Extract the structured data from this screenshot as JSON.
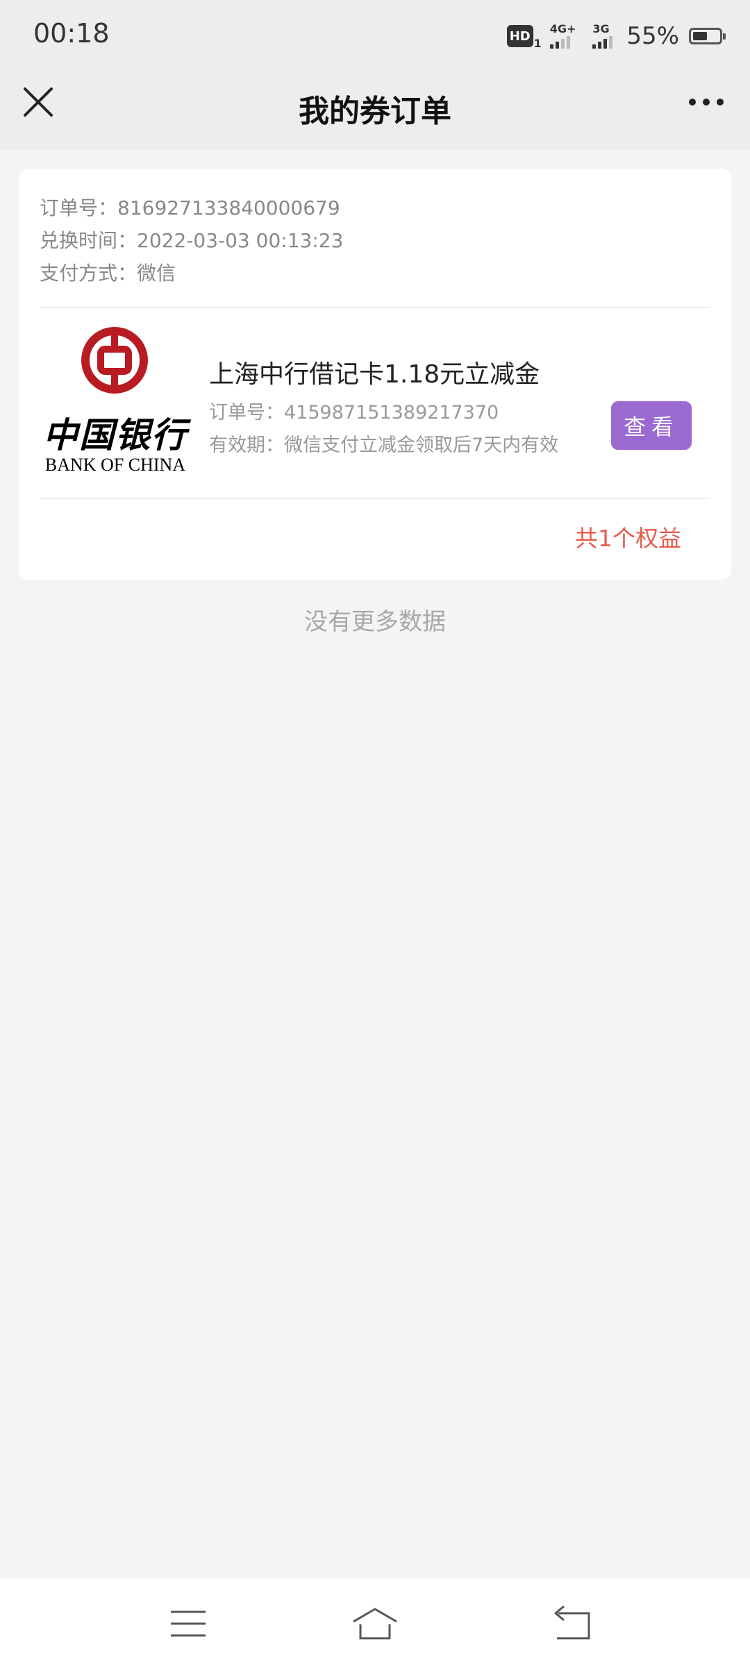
{
  "status_bar": {
    "time": "00:18",
    "hd_label": "HD",
    "hd_sub": "1",
    "network_1": "4G+",
    "network_2": "3G",
    "battery_percent": "55%",
    "battery_level": 0.55
  },
  "nav": {
    "title": "我的券订单",
    "close_icon": "close-icon",
    "more_icon": "more-icon"
  },
  "order": {
    "order_no_label": "订单号：",
    "order_no": "816927133840000679",
    "exchange_time_label": "兑换时间：",
    "exchange_time": "2022-03-03 00:13:23",
    "payment_label": "支付方式：",
    "payment": "微信",
    "item": {
      "logo_cn": "中国银行",
      "logo_en": "BANK OF CHINA",
      "title": "上海中行借记卡1.18元立减金",
      "order_no_label": "订单号：",
      "order_no": "415987151389217370",
      "validity_label": "有效期：",
      "validity": "微信支付立减金领取后7天内有效",
      "view_button": "查看"
    },
    "total": "共1个权益"
  },
  "footer": {
    "no_more": "没有更多数据"
  },
  "colors": {
    "accent_button": "#9b6ad0",
    "total_text": "#e85c4b",
    "bank_red": "#b81c22"
  }
}
